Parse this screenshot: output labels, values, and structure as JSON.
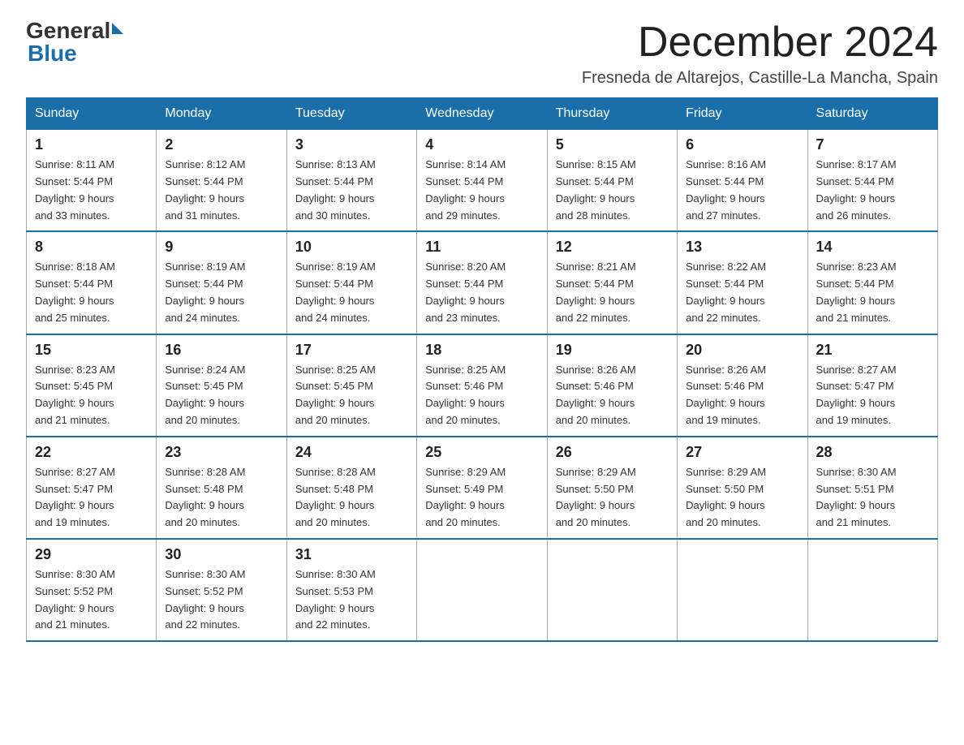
{
  "header": {
    "logo_text": "General",
    "logo_blue": "Blue",
    "month_year": "December 2024",
    "location": "Fresneda de Altarejos, Castille-La Mancha, Spain"
  },
  "days_of_week": [
    "Sunday",
    "Monday",
    "Tuesday",
    "Wednesday",
    "Thursday",
    "Friday",
    "Saturday"
  ],
  "weeks": [
    [
      {
        "day": "1",
        "sunrise": "8:11 AM",
        "sunset": "5:44 PM",
        "daylight": "9 hours and 33 minutes."
      },
      {
        "day": "2",
        "sunrise": "8:12 AM",
        "sunset": "5:44 PM",
        "daylight": "9 hours and 31 minutes."
      },
      {
        "day": "3",
        "sunrise": "8:13 AM",
        "sunset": "5:44 PM",
        "daylight": "9 hours and 30 minutes."
      },
      {
        "day": "4",
        "sunrise": "8:14 AM",
        "sunset": "5:44 PM",
        "daylight": "9 hours and 29 minutes."
      },
      {
        "day": "5",
        "sunrise": "8:15 AM",
        "sunset": "5:44 PM",
        "daylight": "9 hours and 28 minutes."
      },
      {
        "day": "6",
        "sunrise": "8:16 AM",
        "sunset": "5:44 PM",
        "daylight": "9 hours and 27 minutes."
      },
      {
        "day": "7",
        "sunrise": "8:17 AM",
        "sunset": "5:44 PM",
        "daylight": "9 hours and 26 minutes."
      }
    ],
    [
      {
        "day": "8",
        "sunrise": "8:18 AM",
        "sunset": "5:44 PM",
        "daylight": "9 hours and 25 minutes."
      },
      {
        "day": "9",
        "sunrise": "8:19 AM",
        "sunset": "5:44 PM",
        "daylight": "9 hours and 24 minutes."
      },
      {
        "day": "10",
        "sunrise": "8:19 AM",
        "sunset": "5:44 PM",
        "daylight": "9 hours and 24 minutes."
      },
      {
        "day": "11",
        "sunrise": "8:20 AM",
        "sunset": "5:44 PM",
        "daylight": "9 hours and 23 minutes."
      },
      {
        "day": "12",
        "sunrise": "8:21 AM",
        "sunset": "5:44 PM",
        "daylight": "9 hours and 22 minutes."
      },
      {
        "day": "13",
        "sunrise": "8:22 AM",
        "sunset": "5:44 PM",
        "daylight": "9 hours and 22 minutes."
      },
      {
        "day": "14",
        "sunrise": "8:23 AM",
        "sunset": "5:44 PM",
        "daylight": "9 hours and 21 minutes."
      }
    ],
    [
      {
        "day": "15",
        "sunrise": "8:23 AM",
        "sunset": "5:45 PM",
        "daylight": "9 hours and 21 minutes."
      },
      {
        "day": "16",
        "sunrise": "8:24 AM",
        "sunset": "5:45 PM",
        "daylight": "9 hours and 20 minutes."
      },
      {
        "day": "17",
        "sunrise": "8:25 AM",
        "sunset": "5:45 PM",
        "daylight": "9 hours and 20 minutes."
      },
      {
        "day": "18",
        "sunrise": "8:25 AM",
        "sunset": "5:46 PM",
        "daylight": "9 hours and 20 minutes."
      },
      {
        "day": "19",
        "sunrise": "8:26 AM",
        "sunset": "5:46 PM",
        "daylight": "9 hours and 20 minutes."
      },
      {
        "day": "20",
        "sunrise": "8:26 AM",
        "sunset": "5:46 PM",
        "daylight": "9 hours and 19 minutes."
      },
      {
        "day": "21",
        "sunrise": "8:27 AM",
        "sunset": "5:47 PM",
        "daylight": "9 hours and 19 minutes."
      }
    ],
    [
      {
        "day": "22",
        "sunrise": "8:27 AM",
        "sunset": "5:47 PM",
        "daylight": "9 hours and 19 minutes."
      },
      {
        "day": "23",
        "sunrise": "8:28 AM",
        "sunset": "5:48 PM",
        "daylight": "9 hours and 20 minutes."
      },
      {
        "day": "24",
        "sunrise": "8:28 AM",
        "sunset": "5:48 PM",
        "daylight": "9 hours and 20 minutes."
      },
      {
        "day": "25",
        "sunrise": "8:29 AM",
        "sunset": "5:49 PM",
        "daylight": "9 hours and 20 minutes."
      },
      {
        "day": "26",
        "sunrise": "8:29 AM",
        "sunset": "5:50 PM",
        "daylight": "9 hours and 20 minutes."
      },
      {
        "day": "27",
        "sunrise": "8:29 AM",
        "sunset": "5:50 PM",
        "daylight": "9 hours and 20 minutes."
      },
      {
        "day": "28",
        "sunrise": "8:30 AM",
        "sunset": "5:51 PM",
        "daylight": "9 hours and 21 minutes."
      }
    ],
    [
      {
        "day": "29",
        "sunrise": "8:30 AM",
        "sunset": "5:52 PM",
        "daylight": "9 hours and 21 minutes."
      },
      {
        "day": "30",
        "sunrise": "8:30 AM",
        "sunset": "5:52 PM",
        "daylight": "9 hours and 22 minutes."
      },
      {
        "day": "31",
        "sunrise": "8:30 AM",
        "sunset": "5:53 PM",
        "daylight": "9 hours and 22 minutes."
      },
      null,
      null,
      null,
      null
    ]
  ]
}
